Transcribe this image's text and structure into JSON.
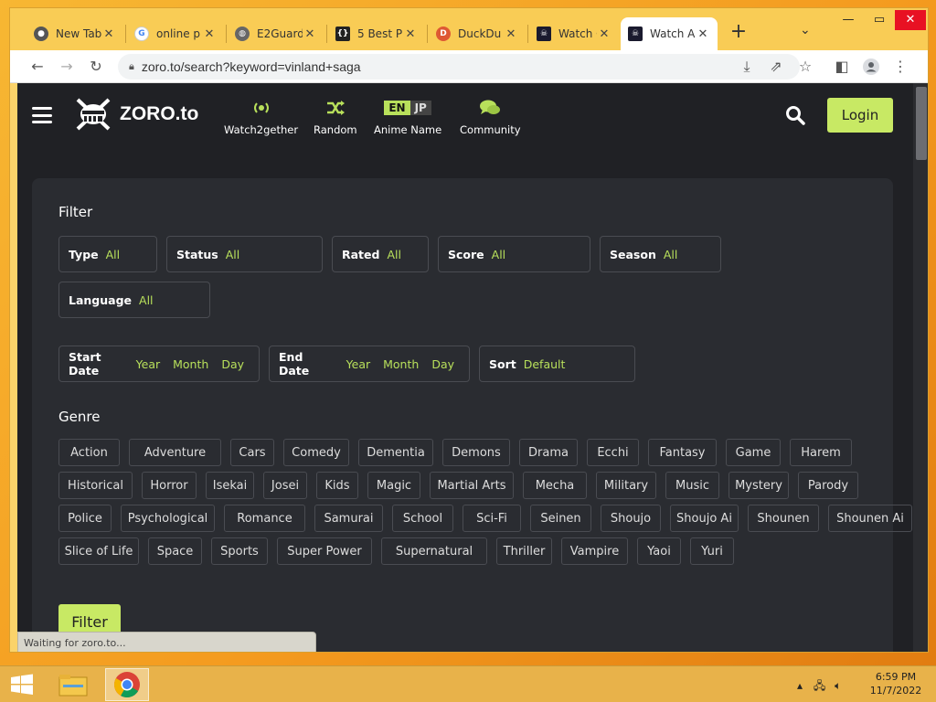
{
  "browser": {
    "tabs": [
      {
        "title": "New Tab",
        "favicon": "chrome-icon",
        "color": "#555555"
      },
      {
        "title": "online p",
        "favicon": "google-icon",
        "color": "#4285f4"
      },
      {
        "title": "E2Guard",
        "favicon": "globe-icon",
        "color": "#666666"
      },
      {
        "title": "5 Best P",
        "favicon": "brackets-icon",
        "color": "#222222"
      },
      {
        "title": "DuckDu",
        "favicon": "duckduckgo-icon",
        "color": "#de5833"
      },
      {
        "title": "Watch C",
        "favicon": "zoro-icon",
        "color": "#1a1a2e"
      },
      {
        "title": "Watch A",
        "favicon": "zoro-icon",
        "color": "#1a1a2e"
      }
    ],
    "address": "zoro.to/search?keyword=vinland+saga",
    "status": "Waiting for zoro.to..."
  },
  "site": {
    "logo": "ZORO.to",
    "nav": [
      {
        "label": "Watch2gether",
        "icon": "broadcast-icon"
      },
      {
        "label": "Random",
        "icon": "shuffle-icon"
      },
      {
        "label": "Anime Name",
        "icon": "en-jp-toggle",
        "en": "EN",
        "jp": "JP"
      },
      {
        "label": "Community",
        "icon": "chat-icon"
      }
    ],
    "login": "Login"
  },
  "filter": {
    "title": "Filter",
    "row1": [
      {
        "label": "Type",
        "value": "All"
      },
      {
        "label": "Status",
        "value": "All"
      },
      {
        "label": "Rated",
        "value": "All"
      },
      {
        "label": "Score",
        "value": "All"
      },
      {
        "label": "Season",
        "value": "All"
      },
      {
        "label": "Language",
        "value": "All"
      }
    ],
    "start_date": {
      "label": "Start Date",
      "year": "Year",
      "month": "Month",
      "day": "Day"
    },
    "end_date": {
      "label": "End Date",
      "year": "Year",
      "month": "Month",
      "day": "Day"
    },
    "sort": {
      "label": "Sort",
      "value": "Default"
    },
    "genre_title": "Genre",
    "genres": [
      "Action",
      "Adventure",
      "Cars",
      "Comedy",
      "Dementia",
      "Demons",
      "Drama",
      "Ecchi",
      "Fantasy",
      "Game",
      "Harem",
      "Historical",
      "Horror",
      "Isekai",
      "Josei",
      "Kids",
      "Magic",
      "Martial Arts",
      "Mecha",
      "Military",
      "Music",
      "Mystery",
      "Parody",
      "Police",
      "Psychological",
      "Romance",
      "Samurai",
      "School",
      "Sci-Fi",
      "Seinen",
      "Shoujo",
      "Shoujo Ai",
      "Shounen",
      "Shounen Ai",
      "Slice of Life",
      "Space",
      "Sports",
      "Super Power",
      "Supernatural",
      "Thriller",
      "Vampire",
      "Yaoi",
      "Yuri"
    ],
    "button": "Filter"
  },
  "taskbar": {
    "time": "6:59 PM",
    "date": "11/7/2022"
  },
  "colors": {
    "accent": "#b8e05b",
    "page_bg": "#202125",
    "panel_bg": "#2a2c31"
  }
}
